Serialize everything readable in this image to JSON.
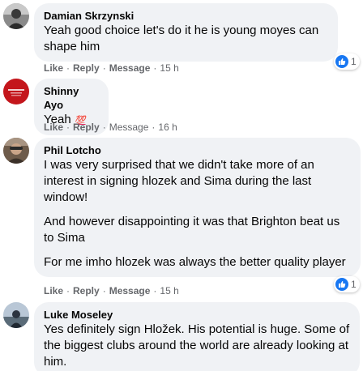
{
  "comments": [
    {
      "author": "Damian Skrzynski",
      "paragraphs": [
        "Yeah good choice let's do it he is young moyes can shape him"
      ],
      "actions": {
        "like": "Like",
        "reply": "Reply",
        "message": "Message",
        "time": "15 h"
      },
      "reaction_count": "1",
      "avatar_icon": "profile-photo"
    },
    {
      "author": "Shinny Ayo",
      "paragraphs": [
        "Yeah"
      ],
      "emoji": "💯",
      "actions": {
        "like": "Like",
        "reply": "Reply",
        "message": "Message",
        "time": "16 h"
      },
      "avatar_icon": "profile-photo"
    },
    {
      "author": "Phil Lotcho",
      "paragraphs": [
        "I was very surprised that we didn't take more of an interest in signing hlozek and Sima during the last window!",
        "And however disappointing it was that Brighton beat us to Sima",
        "For me imho hlozek was always the better quality player"
      ],
      "actions": {
        "like": "Like",
        "reply": "Reply",
        "message": "Message",
        "time": "15 h"
      },
      "reaction_count": "1",
      "avatar_icon": "profile-photo"
    },
    {
      "author": "Luke Moseley",
      "paragraphs": [
        "Yes definitely sign Hložek. His potential is huge. Some of the biggest clubs around the world are already looking at him."
      ],
      "avatar_icon": "profile-photo"
    }
  ],
  "separator": "·",
  "colors": {
    "bubble": "#f0f2f5",
    "meta": "#65676b",
    "like_blue": "#1877f2"
  }
}
